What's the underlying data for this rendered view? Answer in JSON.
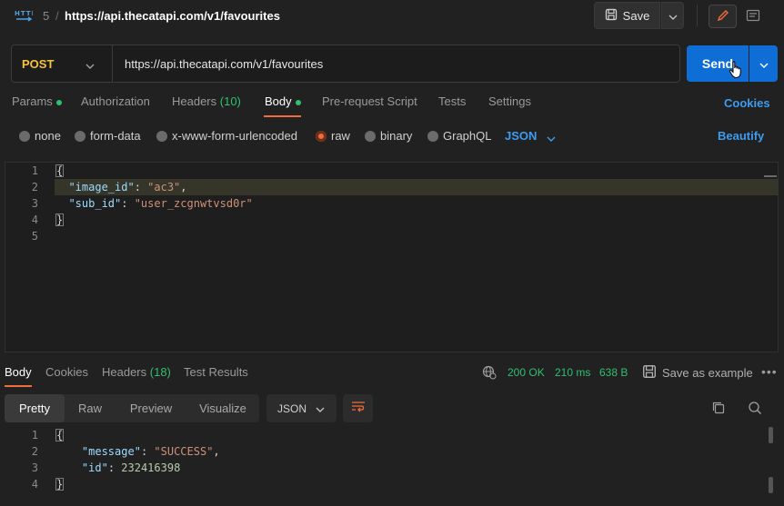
{
  "header": {
    "request_number": "5",
    "separator": "/",
    "title": "https://api.thecatapi.com/v1/favourites",
    "save_label": "Save"
  },
  "request": {
    "method": "POST",
    "url": "https://api.thecatapi.com/v1/favourites",
    "send_label": "Send"
  },
  "tabs": {
    "params": "Params",
    "authorization": "Authorization",
    "headers": "Headers",
    "headers_count": "(10)",
    "body": "Body",
    "prerequest": "Pre-request Script",
    "tests": "Tests",
    "settings": "Settings",
    "cookies": "Cookies"
  },
  "body_types": {
    "none": "none",
    "form_data": "form-data",
    "urlencoded": "x-www-form-urlencoded",
    "raw": "raw",
    "binary": "binary",
    "graphql": "GraphQL",
    "format": "JSON",
    "beautify": "Beautify"
  },
  "editor": {
    "line_numbers": [
      "1",
      "2",
      "3",
      "4",
      "5"
    ],
    "open_brace": "{",
    "close_brace": "}",
    "line2_key": "\"image_id\"",
    "line2_val": "\"ac3\"",
    "line3_key": "\"sub_id\"",
    "line3_val": "\"user_zcgnwtvsd0r\""
  },
  "response": {
    "tabs": {
      "body": "Body",
      "cookies": "Cookies",
      "headers": "Headers",
      "headers_count": "(18)",
      "test_results": "Test Results"
    },
    "status": "200 OK",
    "time": "210 ms",
    "size": "638 B",
    "save_as_example": "Save as example",
    "more": "•••",
    "views": {
      "pretty": "Pretty",
      "raw": "Raw",
      "preview": "Preview",
      "visualize": "Visualize"
    },
    "format": "JSON",
    "line_numbers": [
      "1",
      "2",
      "3",
      "4"
    ],
    "open_brace": "{",
    "close_brace": "}",
    "line2_key": "\"message\"",
    "line2_val": "\"SUCCESS\"",
    "line3_key": "\"id\"",
    "line3_val": "232416398"
  },
  "colors": {
    "accent_orange": "#f26b3a",
    "send_blue": "#0f6ed6",
    "link_blue": "#3d9cf0",
    "success_green": "#2fbf71",
    "method_yellow": "#f4c43f"
  }
}
